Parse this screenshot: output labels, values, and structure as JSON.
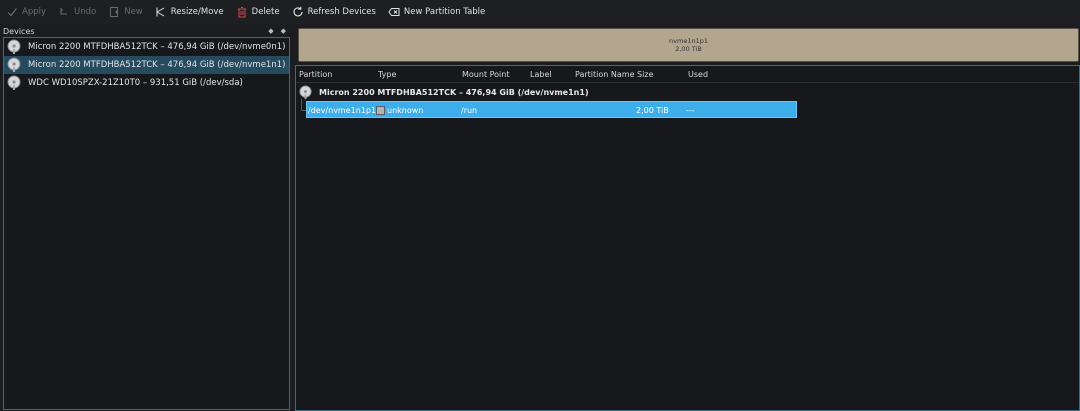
{
  "toolbar": {
    "apply": "Apply",
    "undo": "Undo",
    "new": "New",
    "resize_move": "Resize/Move",
    "delete": "Delete",
    "refresh_devices": "Refresh Devices",
    "new_partition_table": "New Partition Table"
  },
  "devices_panel": {
    "title": "Devices",
    "items": [
      {
        "label": "Micron 2200 MTFDHBA512TCK – 476,94 GiB (/dev/nvme0n1)",
        "selected": false
      },
      {
        "label": "Micron 2200 MTFDHBA512TCK – 476,94 GiB (/dev/nvme1n1)",
        "selected": true
      },
      {
        "label": "WDC WD10SPZX-21Z10T0 – 931,51 GiB (/dev/sda)",
        "selected": false
      }
    ]
  },
  "partition_graphic": {
    "name": "nvme1n1p1",
    "size": "2,00 TiB"
  },
  "partition_table": {
    "columns": [
      "Partition",
      "Type",
      "Mount Point",
      "Label",
      "Partition Name",
      "Size",
      "Used"
    ],
    "device_label": "Micron 2200 MTFDHBA512TCK – 476,94 GiB (/dev/nvme1n1)",
    "rows": [
      {
        "partition": "/dev/nvme1n1p1",
        "type": "unknown",
        "mount_point": "/run",
        "label": "",
        "partition_name": "",
        "size": "2,00 TiB",
        "used": "---"
      }
    ]
  },
  "colors": {
    "selection": "#3daee9",
    "device_selected": "#264a5e",
    "partition_fill": "#b3a68f",
    "accent_border": "#3d6b86"
  }
}
